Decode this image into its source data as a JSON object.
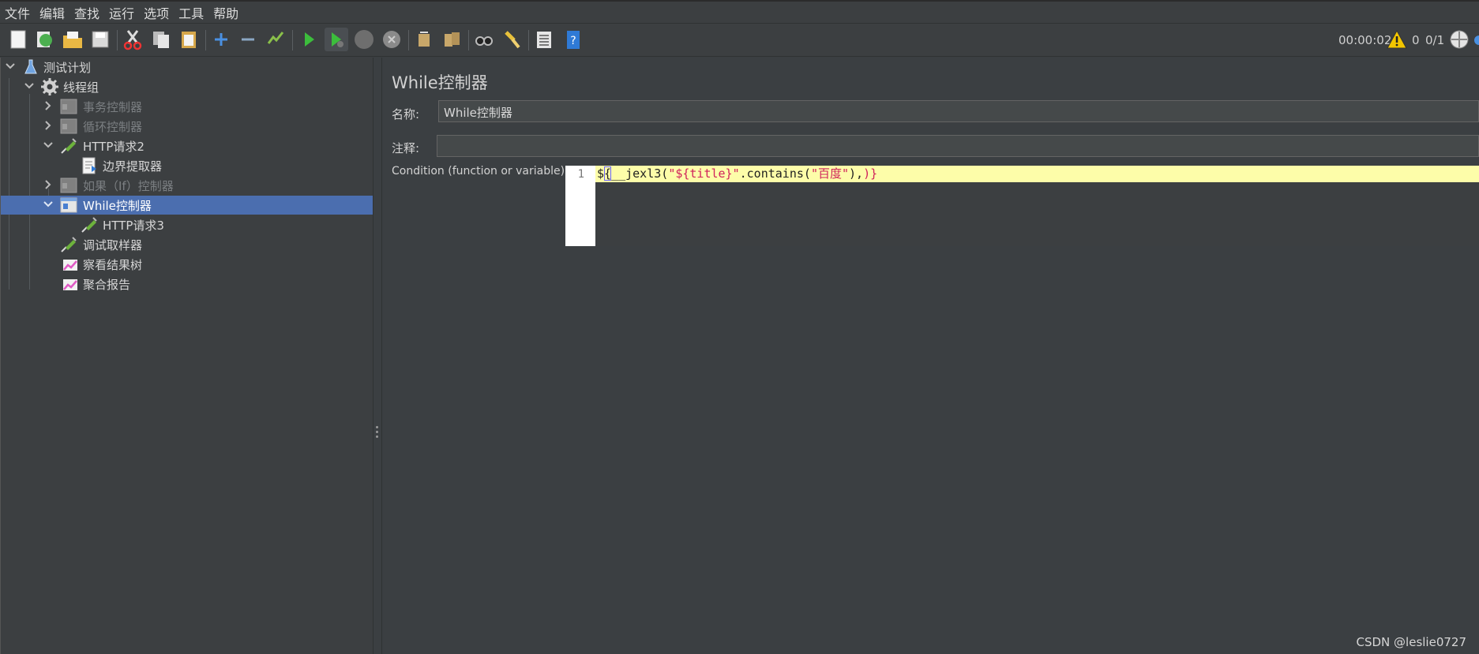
{
  "menu": [
    "文件",
    "编辑",
    "查找",
    "运行",
    "选项",
    "工具",
    "帮助"
  ],
  "toolbar": {
    "buttons": [
      "new-icon",
      "templates-icon",
      "open-icon",
      "save-icon",
      "cut-icon",
      "copy-icon",
      "paste-icon",
      "add-icon",
      "remove-icon",
      "toggle-icon",
      "start-icon",
      "start-no-pause-icon",
      "stop-icon",
      "shutdown-icon",
      "clear-icon",
      "clear-all-icon",
      "search-icon",
      "reset-search-icon",
      "function-helper-icon",
      "help-icon"
    ]
  },
  "status": {
    "timer": "00:00:02",
    "warnings": "0",
    "threads": "0/1"
  },
  "tree": [
    {
      "label": "测试计划",
      "icon": "test-plan-icon",
      "disabled": false,
      "selected": false
    },
    {
      "label": "线程组",
      "icon": "thread-group-icon",
      "disabled": false,
      "selected": false
    },
    {
      "label": "事务控制器",
      "icon": "controller-icon",
      "disabled": true,
      "selected": false
    },
    {
      "label": "循环控制器",
      "icon": "controller-icon",
      "disabled": true,
      "selected": false
    },
    {
      "label": "HTTP请求2",
      "icon": "sampler-icon",
      "disabled": false,
      "selected": false
    },
    {
      "label": "边界提取器",
      "icon": "extractor-icon",
      "disabled": false,
      "selected": false
    },
    {
      "label": "如果（If）控制器",
      "icon": "controller-icon",
      "disabled": true,
      "selected": false
    },
    {
      "label": "While控制器",
      "icon": "while-controller-icon",
      "disabled": false,
      "selected": true
    },
    {
      "label": "HTTP请求3",
      "icon": "sampler-icon",
      "disabled": false,
      "selected": false
    },
    {
      "label": "调试取样器",
      "icon": "sampler-icon",
      "disabled": false,
      "selected": false
    },
    {
      "label": "察看结果树",
      "icon": "listener-icon",
      "disabled": false,
      "selected": false
    },
    {
      "label": "聚合报告",
      "icon": "listener-icon",
      "disabled": false,
      "selected": false
    }
  ],
  "panel": {
    "title": "While控制器",
    "name_label": "名称:",
    "name_value": "While控制器",
    "comment_label": "注释:",
    "comment_value": "",
    "condition_label": "Condition (function or variable)",
    "line_number": "1",
    "code": {
      "p1": "$",
      "p2": "{",
      "p3": "__jexl3(",
      "p4": "\"${title}\"",
      "p5": ".contains(",
      "p6": "\"百度\"",
      "p7": "),",
      "p8": ")}"
    }
  },
  "watermark": "CSDN @leslie0727",
  "colors": {
    "background": "#3b3f42",
    "selected_row": "#4b6eaf",
    "editor_line": "#fdfda9",
    "code_red": "#d0215b"
  }
}
